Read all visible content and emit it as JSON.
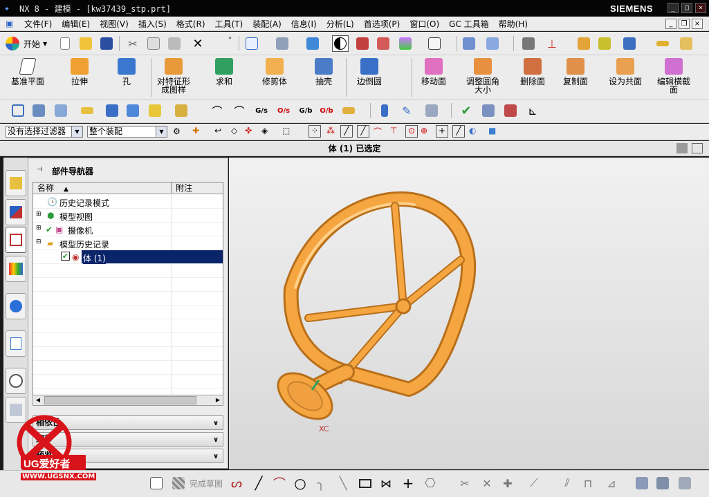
{
  "window": {
    "title": "NX 8 - 建模 - [kw37439_stp.prt]",
    "brand": "SIEMENS",
    "controls": {
      "minimize": "_",
      "restore": "□",
      "close": "×"
    }
  },
  "menu": [
    "文件(F)",
    "编辑(E)",
    "视图(V)",
    "插入(S)",
    "格式(R)",
    "工具(T)",
    "装配(A)",
    "信息(I)",
    "分析(L)",
    "首选项(P)",
    "窗口(O)",
    "GC 工具箱",
    "帮助(H)"
  ],
  "standard_toolbar": {
    "start_label": "开始"
  },
  "feature_toolbar": {
    "buttons": [
      "基准平面",
      "拉伸",
      "孔",
      "对特征形成图样",
      "求和",
      "修剪体",
      "抽壳",
      "边倒圆",
      "移动面",
      "调整圆角大小",
      "删除面",
      "复制面",
      "设为共面",
      "编辑横截面"
    ]
  },
  "filter_bar": {
    "selection_filter": "没有选择过滤器",
    "scope": "整个装配"
  },
  "status": {
    "text": "体 (1) 已选定"
  },
  "part_navigator": {
    "title": "部件导航器",
    "columns": [
      "名称",
      "附注"
    ],
    "rows": [
      {
        "label": "历史记录模式",
        "indent": 0,
        "icon": "clock-icon"
      },
      {
        "label": "模型视图",
        "indent": 0,
        "icon": "model-view-icon"
      },
      {
        "label": "摄像机",
        "indent": 0,
        "icon": "camera-icon"
      },
      {
        "label": "模型历史记录",
        "indent": 0,
        "icon": "folder-icon"
      },
      {
        "label": "体 (1)",
        "indent": 1,
        "icon": "body-icon",
        "selected": true
      }
    ],
    "panels": [
      "相依性",
      "细节",
      "预览"
    ]
  },
  "viewport": {
    "axis_label": "XC",
    "model_color": "#f5a640"
  },
  "bottom_toolbar": {
    "sketch_label": "完成草图"
  },
  "watermark": {
    "brand": "UG爱好者",
    "url": "WWW.UGSNX.COM"
  }
}
